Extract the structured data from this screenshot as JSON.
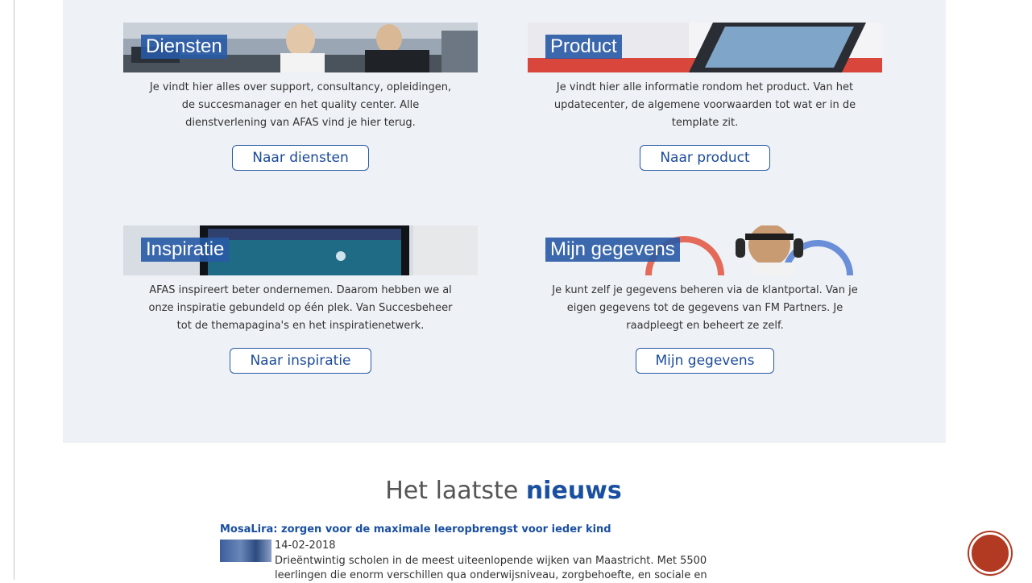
{
  "cards": [
    {
      "title": "Diensten",
      "description": "Je vindt hier alles over support, consultancy, opleidingen, de succesmanager en het quality center. Alle dienstverlening van AFAS vind je hier terug.",
      "button": "Naar diensten"
    },
    {
      "title": "Product",
      "description": "Je vindt hier alle informatie rondom het product. Van het updatecenter, de algemene voorwaarden tot wat er in de template zit.",
      "button": "Naar product"
    },
    {
      "title": "Inspiratie",
      "description": "AFAS inspireert beter ondernemen. Daarom hebben we al onze inspiratie gebundeld op één plek. Van Succesbeheer tot de themapagina's en het inspiratienetwerk.",
      "button": "Naar inspiratie"
    },
    {
      "title": "Mijn gegevens",
      "description": "Je kunt zelf je gegevens beheren via de klantportal. Van je eigen gegevens tot de gegevens van FM Partners. Je raadpleegt en beheert ze zelf.",
      "button": "Mijn gegevens"
    }
  ],
  "news": {
    "heading_prefix": "Het laatste",
    "heading_emphasis": "nieuws",
    "article": {
      "headline": "MosaLira: zorgen voor de maximale leeropbrengst voor ieder kind",
      "date": "14-02-2018",
      "body": "Drieëntwintig scholen in de meest uiteenlopende wijken van Maastricht. Met 5500 leerlingen die enorm verschillen qua onderwijsniveau, zorgbehoefte, en sociale en"
    }
  },
  "colors": {
    "accent": "#1a4fa0",
    "panel_bg": "#eef1f6",
    "slide_button": "#b23a22"
  }
}
